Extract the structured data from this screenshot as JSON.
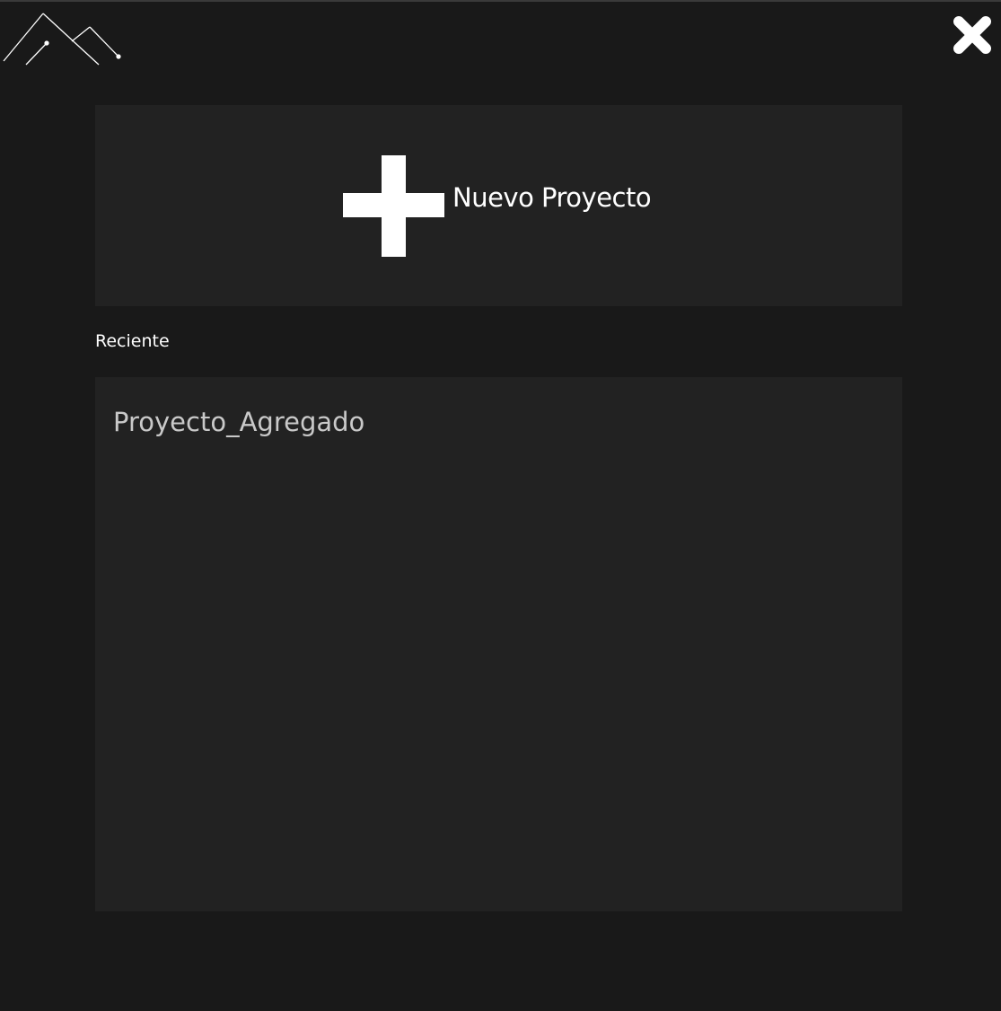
{
  "header": {
    "logo_icon": "mountain-peaks-logo-icon",
    "close_icon": "close-icon"
  },
  "new_project": {
    "icon": "plus-icon",
    "label": "Nuevo Proyecto"
  },
  "recent": {
    "label": "Reciente",
    "items": [
      {
        "name": "Proyecto_Agregado"
      }
    ]
  },
  "colors": {
    "background": "#191919",
    "panel": "#222222",
    "text": "#ffffff",
    "item_text": "#c9c9c9"
  }
}
